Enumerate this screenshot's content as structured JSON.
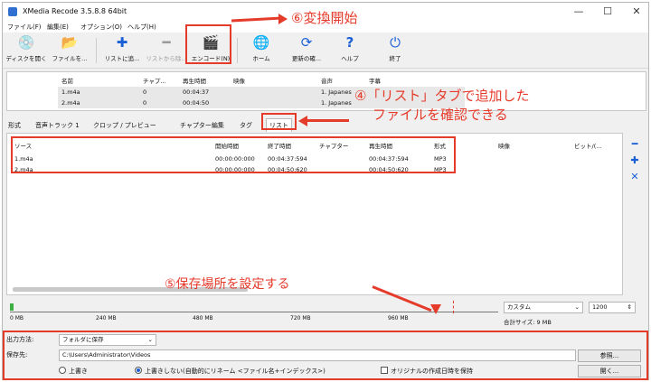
{
  "window": {
    "title": "XMedia Recode 3.5.8.8 64bit",
    "minimize": "—",
    "maximize": "☐",
    "close": "✕"
  },
  "menu": [
    "ファイル(F)",
    "編集(E)",
    "オプション(O)",
    "ヘルプ(H)"
  ],
  "toolbar": [
    {
      "label": "ディスクを開く",
      "icon": "disc-icon",
      "glyph": "💿",
      "enabled": true
    },
    {
      "label": "ファイルを...",
      "icon": "file-open-icon",
      "glyph": "📂",
      "enabled": true
    },
    {
      "label": "リストに追...",
      "icon": "add-icon",
      "glyph": "✚",
      "enabled": true
    },
    {
      "label": "リストから除...",
      "icon": "remove-icon",
      "glyph": "━",
      "enabled": false
    },
    {
      "label": "エンコード(N)",
      "icon": "encode-icon",
      "glyph": "🎬",
      "enabled": true
    },
    {
      "label": "ホーム",
      "icon": "globe-icon",
      "glyph": "🌐",
      "enabled": true
    },
    {
      "label": "更新の確...",
      "icon": "refresh-icon",
      "glyph": "⟳",
      "enabled": true
    },
    {
      "label": "ヘルプ",
      "icon": "help-icon",
      "glyph": "?",
      "enabled": true
    },
    {
      "label": "終了",
      "icon": "power-icon",
      "glyph": "⏻",
      "enabled": true
    }
  ],
  "top_table": {
    "headers": [
      "名前",
      "チャプ...",
      "再生時間",
      "映像",
      "音声",
      "字幕"
    ],
    "rows": [
      [
        "1.m4a",
        "0",
        "00:04:37",
        "",
        "1. Japanes",
        ""
      ],
      [
        "2.m4a",
        "0",
        "00:04:50",
        "",
        "1. Japanes",
        ""
      ]
    ]
  },
  "tabs": [
    "形式",
    "音声トラック 1",
    "クロップ / プレビュー",
    "チャプター編集",
    "タグ",
    "リスト"
  ],
  "list_table": {
    "headers": [
      "ソース",
      "開始時間",
      "終了時間",
      "チャプター",
      "再生時間",
      "形式",
      "映像",
      "ビット/(..."
    ],
    "rows": [
      [
        "1.m4a",
        "00:00:00:000",
        "00:04:37:594",
        "",
        "00:04:37:594",
        "MP3",
        "",
        ""
      ],
      [
        "2.m4a",
        "00:00:00:000",
        "00:04:50:620",
        "",
        "00:04:50:620",
        "MP3",
        "",
        ""
      ]
    ]
  },
  "side_buttons": [
    {
      "glyph": "━",
      "icon": "remove-icon"
    },
    {
      "glyph": "✚",
      "icon": "add-icon"
    },
    {
      "glyph": "✕",
      "icon": "clear-icon"
    }
  ],
  "size_bar": {
    "ticks": [
      "0 MB",
      "240 MB",
      "480 MB",
      "720 MB",
      "960 MB"
    ],
    "preset": "カスタム",
    "target": "1200",
    "total": "合計サイズ: 9 MB"
  },
  "output": {
    "method_label": "出力方法:",
    "method_value": "フォルダに保存",
    "dest_label": "保存先:",
    "dest_value": "C:\\Users\\Administrator\\Videos",
    "browse": "参照...",
    "open": "開く...",
    "overwrite": "上書き",
    "no_overwrite": "上書きしない(自動的にリネーム <ファイル名+インデックス>)",
    "keep_date": "オリジナルの作成日時を保持"
  },
  "annotations": {
    "a6": "⑥変換開始",
    "a4_line1": "④「リスト」タブで追加した",
    "a4_line2": "ファイルを確認できる",
    "a5": "⑤保存場所を設定する"
  },
  "colors": {
    "annotation": "#e53b2b",
    "accent": "#1a5fd6"
  }
}
